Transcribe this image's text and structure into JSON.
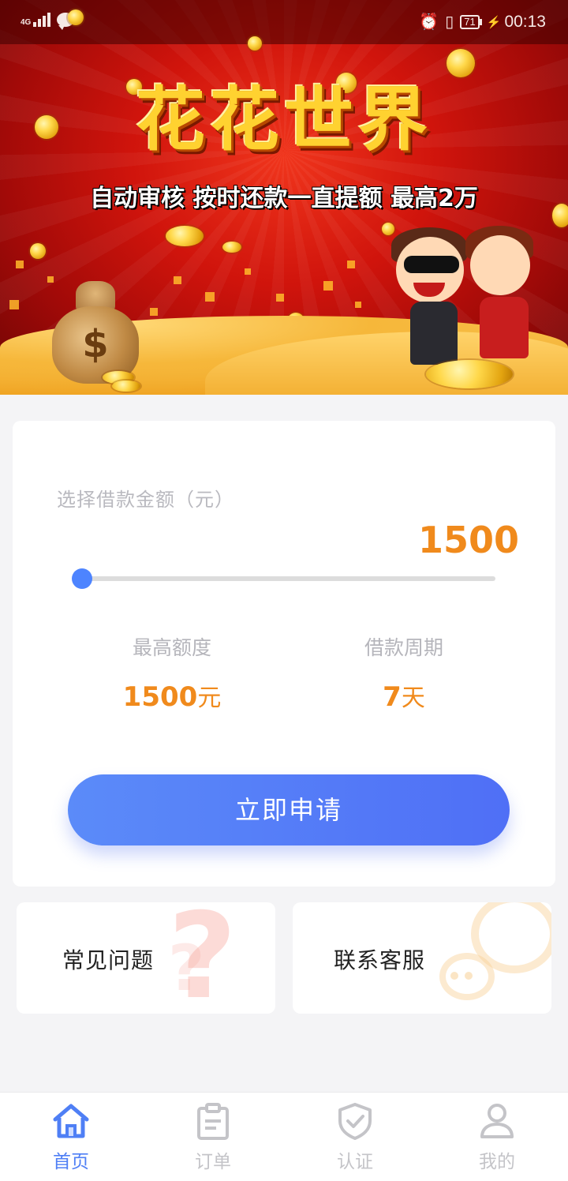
{
  "status_bar": {
    "network": "4G",
    "battery": "71",
    "time": "00:13"
  },
  "banner": {
    "title": "花花世界",
    "subtitle": "自动审核  按时还款一直提额  最高2万"
  },
  "loan": {
    "select_label": "选择借款金额（元）",
    "amount": "1500",
    "slider_fraction": 0,
    "max_limit_label": "最高额度",
    "max_limit_value": "1500",
    "max_limit_unit": "元",
    "period_label": "借款周期",
    "period_value": "7",
    "period_unit": "天",
    "apply_button": "立即申请"
  },
  "quick": {
    "faq": "常见问题",
    "contact": "联系客服"
  },
  "tabs": [
    {
      "label": "首页",
      "icon": "home-icon"
    },
    {
      "label": "订单",
      "icon": "clipboard-icon"
    },
    {
      "label": "认证",
      "icon": "shield-check-icon"
    },
    {
      "label": "我的",
      "icon": "user-icon"
    }
  ],
  "colors": {
    "accent": "#4f7ff5",
    "amount": "#f08a1c",
    "banner_red": "#d0140c"
  }
}
